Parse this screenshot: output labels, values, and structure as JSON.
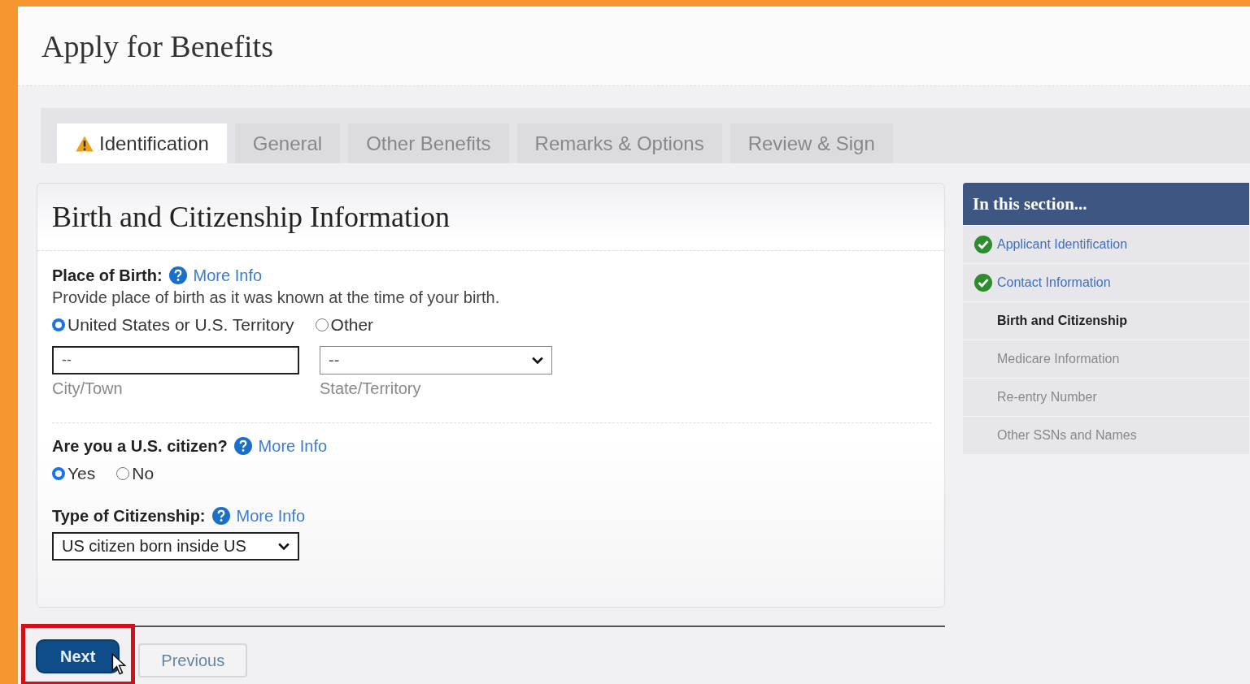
{
  "page_title": "Apply for Benefits",
  "tabs": [
    {
      "label": "Identification",
      "selected": true,
      "warning": true
    },
    {
      "label": "General",
      "selected": false,
      "warning": false
    },
    {
      "label": "Other Benefits",
      "selected": false,
      "warning": false
    },
    {
      "label": "Remarks & Options",
      "selected": false,
      "warning": false
    },
    {
      "label": "Review & Sign",
      "selected": false,
      "warning": false
    }
  ],
  "panel": {
    "title": "Birth and Citizenship Information",
    "place_of_birth": {
      "label": "Place of Birth:",
      "more_info": "More Info",
      "hint": "Provide place of birth as it was known at the time of your birth.",
      "options": [
        {
          "label": "United States or U.S. Territory",
          "selected": true
        },
        {
          "label": "Other",
          "selected": false
        }
      ],
      "city": {
        "value": "--",
        "caption": "City/Town"
      },
      "state": {
        "value": "--",
        "caption": "State/Territory"
      }
    },
    "citizen": {
      "label": "Are you a U.S. citizen?",
      "more_info": "More Info",
      "options": [
        {
          "label": "Yes",
          "selected": true
        },
        {
          "label": "No",
          "selected": false
        }
      ]
    },
    "citizenship_type": {
      "label": "Type of Citizenship:",
      "more_info": "More Info",
      "value": "US citizen born inside US"
    }
  },
  "sidebar": {
    "title": "In this section...",
    "items": [
      {
        "label": "Applicant Identification",
        "complete": true,
        "selected": false
      },
      {
        "label": "Contact Information",
        "complete": true,
        "selected": false
      },
      {
        "label": "Birth and Citizenship",
        "complete": false,
        "selected": true
      },
      {
        "label": "Medicare Information",
        "complete": false,
        "selected": false
      },
      {
        "label": "Re-entry Number",
        "complete": false,
        "selected": false
      },
      {
        "label": "Other SSNs and Names",
        "complete": false,
        "selected": false
      }
    ]
  },
  "buttons": [
    {
      "label": "Next",
      "kind": "primary",
      "highlighted": true
    },
    {
      "label": "Previous",
      "kind": "secondary",
      "highlighted": false
    }
  ]
}
